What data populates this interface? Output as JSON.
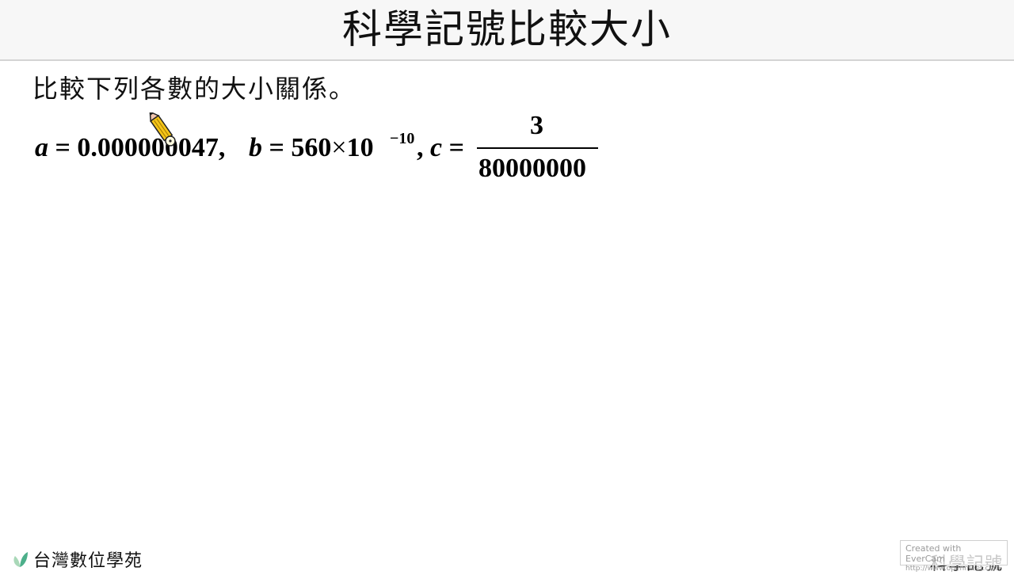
{
  "slide": {
    "title": "科學記號比較大小",
    "question": "比較下列各數的大小關係。",
    "expression": {
      "a_var": "a",
      "equals": "=",
      "a_value": "0.000000047",
      "comma1": ",",
      "b_var": "b",
      "b_mantissa": "560",
      "times": "×",
      "b_base": "10",
      "b_exponent": "−10",
      "comma2": ",",
      "c_var": "c",
      "c_numerator": "3",
      "c_denominator": "80000000"
    },
    "cursor_icon": "pencil-icon"
  },
  "footer": {
    "brand_icon": "leaf-icon",
    "brand_name": "台灣數位學苑",
    "corner_label": "科學記號"
  },
  "watermark": {
    "line1": "Created with EverCam",
    "line2": "http://www.openmeet.com"
  }
}
